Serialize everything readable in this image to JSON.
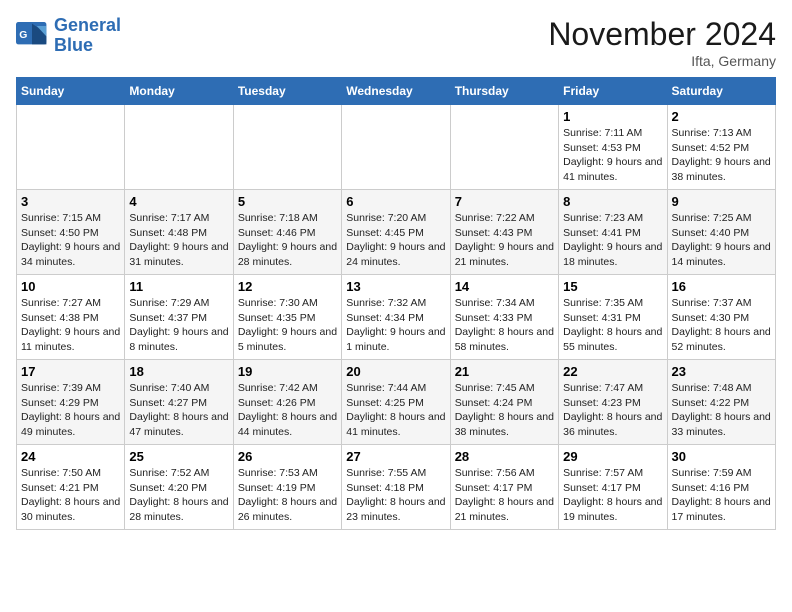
{
  "logo": {
    "line1": "General",
    "line2": "Blue"
  },
  "title": "November 2024",
  "location": "Ifta, Germany",
  "weekdays": [
    "Sunday",
    "Monday",
    "Tuesday",
    "Wednesday",
    "Thursday",
    "Friday",
    "Saturday"
  ],
  "weeks": [
    [
      {
        "day": "",
        "sunrise": "",
        "sunset": "",
        "daylight": ""
      },
      {
        "day": "",
        "sunrise": "",
        "sunset": "",
        "daylight": ""
      },
      {
        "day": "",
        "sunrise": "",
        "sunset": "",
        "daylight": ""
      },
      {
        "day": "",
        "sunrise": "",
        "sunset": "",
        "daylight": ""
      },
      {
        "day": "",
        "sunrise": "",
        "sunset": "",
        "daylight": ""
      },
      {
        "day": "1",
        "sunrise": "Sunrise: 7:11 AM",
        "sunset": "Sunset: 4:53 PM",
        "daylight": "Daylight: 9 hours and 41 minutes."
      },
      {
        "day": "2",
        "sunrise": "Sunrise: 7:13 AM",
        "sunset": "Sunset: 4:52 PM",
        "daylight": "Daylight: 9 hours and 38 minutes."
      }
    ],
    [
      {
        "day": "3",
        "sunrise": "Sunrise: 7:15 AM",
        "sunset": "Sunset: 4:50 PM",
        "daylight": "Daylight: 9 hours and 34 minutes."
      },
      {
        "day": "4",
        "sunrise": "Sunrise: 7:17 AM",
        "sunset": "Sunset: 4:48 PM",
        "daylight": "Daylight: 9 hours and 31 minutes."
      },
      {
        "day": "5",
        "sunrise": "Sunrise: 7:18 AM",
        "sunset": "Sunset: 4:46 PM",
        "daylight": "Daylight: 9 hours and 28 minutes."
      },
      {
        "day": "6",
        "sunrise": "Sunrise: 7:20 AM",
        "sunset": "Sunset: 4:45 PM",
        "daylight": "Daylight: 9 hours and 24 minutes."
      },
      {
        "day": "7",
        "sunrise": "Sunrise: 7:22 AM",
        "sunset": "Sunset: 4:43 PM",
        "daylight": "Daylight: 9 hours and 21 minutes."
      },
      {
        "day": "8",
        "sunrise": "Sunrise: 7:23 AM",
        "sunset": "Sunset: 4:41 PM",
        "daylight": "Daylight: 9 hours and 18 minutes."
      },
      {
        "day": "9",
        "sunrise": "Sunrise: 7:25 AM",
        "sunset": "Sunset: 4:40 PM",
        "daylight": "Daylight: 9 hours and 14 minutes."
      }
    ],
    [
      {
        "day": "10",
        "sunrise": "Sunrise: 7:27 AM",
        "sunset": "Sunset: 4:38 PM",
        "daylight": "Daylight: 9 hours and 11 minutes."
      },
      {
        "day": "11",
        "sunrise": "Sunrise: 7:29 AM",
        "sunset": "Sunset: 4:37 PM",
        "daylight": "Daylight: 9 hours and 8 minutes."
      },
      {
        "day": "12",
        "sunrise": "Sunrise: 7:30 AM",
        "sunset": "Sunset: 4:35 PM",
        "daylight": "Daylight: 9 hours and 5 minutes."
      },
      {
        "day": "13",
        "sunrise": "Sunrise: 7:32 AM",
        "sunset": "Sunset: 4:34 PM",
        "daylight": "Daylight: 9 hours and 1 minute."
      },
      {
        "day": "14",
        "sunrise": "Sunrise: 7:34 AM",
        "sunset": "Sunset: 4:33 PM",
        "daylight": "Daylight: 8 hours and 58 minutes."
      },
      {
        "day": "15",
        "sunrise": "Sunrise: 7:35 AM",
        "sunset": "Sunset: 4:31 PM",
        "daylight": "Daylight: 8 hours and 55 minutes."
      },
      {
        "day": "16",
        "sunrise": "Sunrise: 7:37 AM",
        "sunset": "Sunset: 4:30 PM",
        "daylight": "Daylight: 8 hours and 52 minutes."
      }
    ],
    [
      {
        "day": "17",
        "sunrise": "Sunrise: 7:39 AM",
        "sunset": "Sunset: 4:29 PM",
        "daylight": "Daylight: 8 hours and 49 minutes."
      },
      {
        "day": "18",
        "sunrise": "Sunrise: 7:40 AM",
        "sunset": "Sunset: 4:27 PM",
        "daylight": "Daylight: 8 hours and 47 minutes."
      },
      {
        "day": "19",
        "sunrise": "Sunrise: 7:42 AM",
        "sunset": "Sunset: 4:26 PM",
        "daylight": "Daylight: 8 hours and 44 minutes."
      },
      {
        "day": "20",
        "sunrise": "Sunrise: 7:44 AM",
        "sunset": "Sunset: 4:25 PM",
        "daylight": "Daylight: 8 hours and 41 minutes."
      },
      {
        "day": "21",
        "sunrise": "Sunrise: 7:45 AM",
        "sunset": "Sunset: 4:24 PM",
        "daylight": "Daylight: 8 hours and 38 minutes."
      },
      {
        "day": "22",
        "sunrise": "Sunrise: 7:47 AM",
        "sunset": "Sunset: 4:23 PM",
        "daylight": "Daylight: 8 hours and 36 minutes."
      },
      {
        "day": "23",
        "sunrise": "Sunrise: 7:48 AM",
        "sunset": "Sunset: 4:22 PM",
        "daylight": "Daylight: 8 hours and 33 minutes."
      }
    ],
    [
      {
        "day": "24",
        "sunrise": "Sunrise: 7:50 AM",
        "sunset": "Sunset: 4:21 PM",
        "daylight": "Daylight: 8 hours and 30 minutes."
      },
      {
        "day": "25",
        "sunrise": "Sunrise: 7:52 AM",
        "sunset": "Sunset: 4:20 PM",
        "daylight": "Daylight: 8 hours and 28 minutes."
      },
      {
        "day": "26",
        "sunrise": "Sunrise: 7:53 AM",
        "sunset": "Sunset: 4:19 PM",
        "daylight": "Daylight: 8 hours and 26 minutes."
      },
      {
        "day": "27",
        "sunrise": "Sunrise: 7:55 AM",
        "sunset": "Sunset: 4:18 PM",
        "daylight": "Daylight: 8 hours and 23 minutes."
      },
      {
        "day": "28",
        "sunrise": "Sunrise: 7:56 AM",
        "sunset": "Sunset: 4:17 PM",
        "daylight": "Daylight: 8 hours and 21 minutes."
      },
      {
        "day": "29",
        "sunrise": "Sunrise: 7:57 AM",
        "sunset": "Sunset: 4:17 PM",
        "daylight": "Daylight: 8 hours and 19 minutes."
      },
      {
        "day": "30",
        "sunrise": "Sunrise: 7:59 AM",
        "sunset": "Sunset: 4:16 PM",
        "daylight": "Daylight: 8 hours and 17 minutes."
      }
    ]
  ]
}
